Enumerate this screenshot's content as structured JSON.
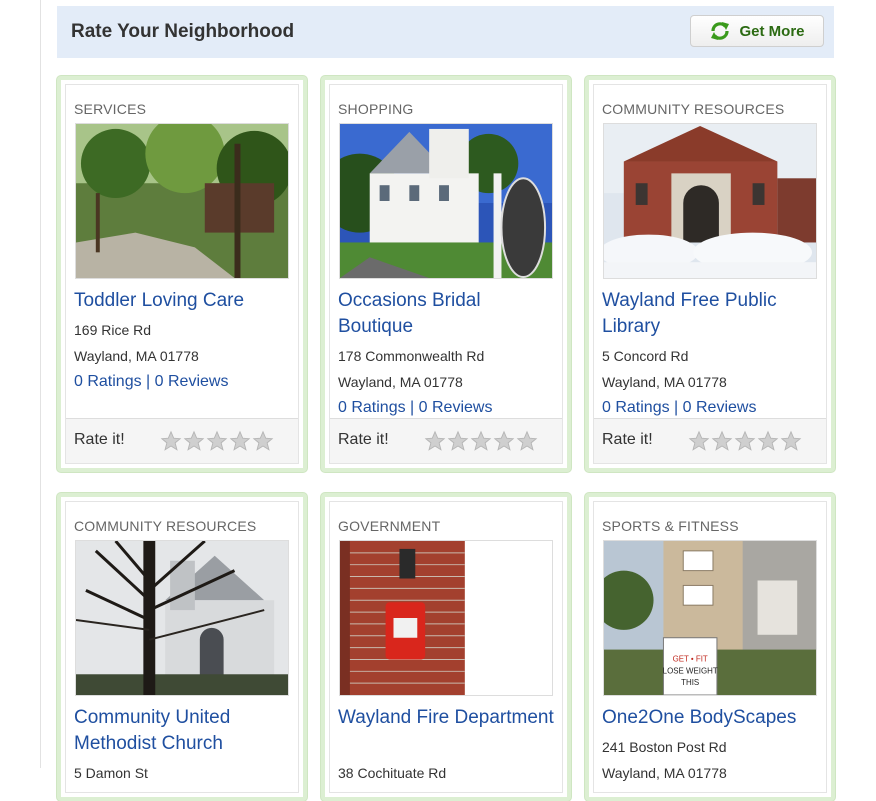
{
  "header": {
    "title": "Rate Your Neighborhood",
    "get_more_label": "Get More",
    "get_more_icon": "refresh-icon",
    "accent": "#2b6a12"
  },
  "rate_label": "Rate it!",
  "ratings_sep": " | ",
  "cards": [
    {
      "category": "SERVICES",
      "name": "Toddler Loving Care",
      "address1": "169 Rice Rd",
      "address2": "Wayland, MA 01778",
      "ratings": "0 Ratings",
      "reviews": "0 Reviews"
    },
    {
      "category": "SHOPPING",
      "name": "Occasions Bridal Boutique",
      "address1": "178 Commonwealth Rd",
      "address2": "Wayland, MA 01778",
      "ratings": "0 Ratings",
      "reviews": "0 Reviews"
    },
    {
      "category": "COMMUNITY RESOURCES",
      "name": "Wayland Free Public Library",
      "address1": "5 Concord Rd",
      "address2": "Wayland, MA 01778",
      "ratings": "0 Ratings",
      "reviews": "0 Reviews"
    },
    {
      "category": "COMMUNITY RESOURCES",
      "name": "Community United Methodist Church",
      "address1": "5 Damon St"
    },
    {
      "category": "GOVERNMENT",
      "name": "Wayland Fire Department",
      "address1": "38 Cochituate Rd"
    },
    {
      "category": "SPORTS & FITNESS",
      "name": "One2One BodyScapes",
      "address1": "241 Boston Post Rd",
      "address2": "Wayland, MA 01778"
    }
  ],
  "photo_sign_text": [
    "GET • FIT",
    "LOSE WEIGHT",
    "THIS"
  ]
}
